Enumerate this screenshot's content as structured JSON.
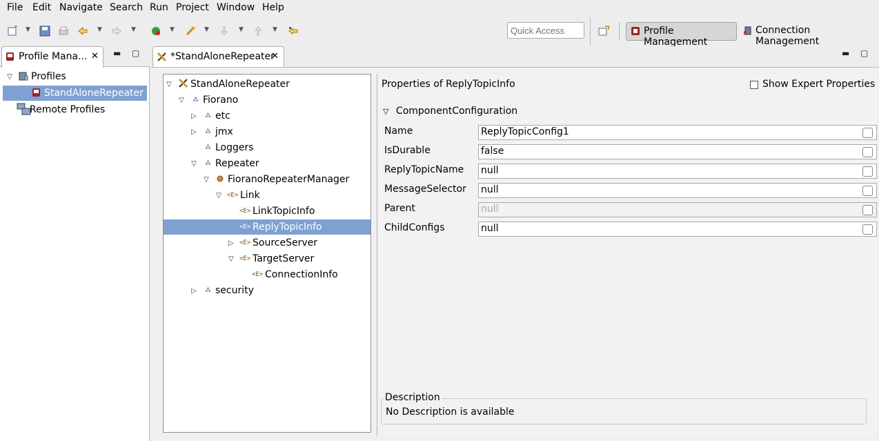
{
  "menu": {
    "file": "File",
    "edit": "Edit",
    "navigate": "Navigate",
    "search": "Search",
    "run": "Run",
    "project": "Project",
    "window": "Window",
    "help": "Help"
  },
  "toolbar": {
    "quick_access_placeholder": "Quick Access",
    "perspectives": {
      "profile_management": "Profile Management",
      "connection_management": "Connection Management"
    }
  },
  "left_view": {
    "tab_title": "Profile Mana...",
    "tree": [
      {
        "label": "Profiles"
      },
      {
        "label": "StandAloneRepeater"
      },
      {
        "label": "Remote Profiles"
      }
    ]
  },
  "editor": {
    "tab_title": "*StandAloneRepeater",
    "tree": [
      {
        "label": "StandAloneRepeater"
      },
      {
        "label": "Fiorano"
      },
      {
        "label": "etc"
      },
      {
        "label": "jmx"
      },
      {
        "label": "Loggers"
      },
      {
        "label": "Repeater"
      },
      {
        "label": "FioranoRepeaterManager"
      },
      {
        "label": "Link"
      },
      {
        "label": "LinkTopicInfo"
      },
      {
        "label": "ReplyTopicInfo"
      },
      {
        "label": "SourceServer"
      },
      {
        "label": "TargetServer"
      },
      {
        "label": "ConnectionInfo"
      },
      {
        "label": "security"
      }
    ],
    "properties": {
      "title": "Properties of ReplyTopicInfo",
      "show_expert_label": "Show Expert Properties",
      "section_title": "ComponentConfiguration",
      "rows": [
        {
          "label": "Name",
          "value": "ReplyTopicConfig1"
        },
        {
          "label": "IsDurable",
          "value": "false"
        },
        {
          "label": "ReplyTopicName",
          "value": "null"
        },
        {
          "label": "MessageSelector",
          "value": "null"
        },
        {
          "label": "Parent",
          "value": "null"
        },
        {
          "label": "ChildConfigs",
          "value": "null"
        }
      ],
      "description_title": "Description",
      "description_text": "No Description is available"
    }
  }
}
